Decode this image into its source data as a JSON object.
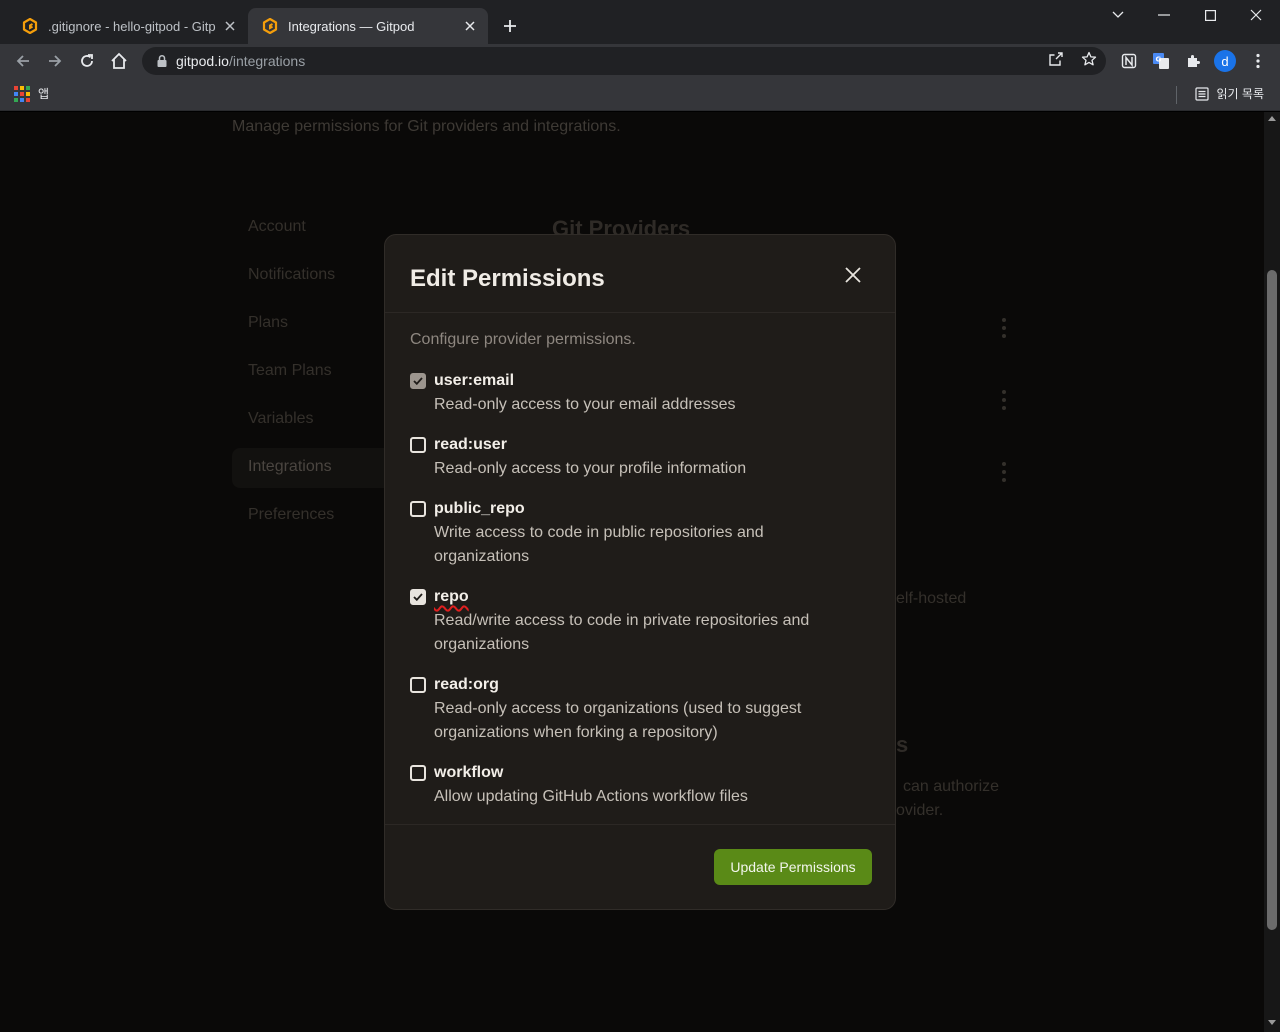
{
  "browser": {
    "tabs": [
      {
        "title": ".gitignore - hello-gitpod - Gitpod",
        "active": false
      },
      {
        "title": "Integrations — Gitpod",
        "active": true
      }
    ],
    "url_host": "gitpod.io",
    "url_path": "/integrations",
    "bookmarks": {
      "apps_label": "앱",
      "reading_list_label": "읽기 목록"
    },
    "profile_initial": "d",
    "colors": {
      "tab_favicon": "#f59e0b",
      "profile": "#1a73e8"
    }
  },
  "page": {
    "subtitle": "Manage permissions for Git providers and integrations.",
    "sidebar": [
      "Account",
      "Notifications",
      "Plans",
      "Team Plans",
      "Variables",
      "Integrations",
      "Preferences"
    ],
    "active_sidebar": "Integrations",
    "section_heading": "Git Providers",
    "partial_texts": {
      "self_hosted": "elf-hosted",
      "heading_fragment": "s",
      "authorize_fragment": "can authorize",
      "provider_fragment": "ovider."
    }
  },
  "modal": {
    "title": "Edit Permissions",
    "description": "Configure provider permissions.",
    "permissions": [
      {
        "name": "user:email",
        "description": "Read-only access to your email addresses",
        "checked": true,
        "disabled": true
      },
      {
        "name": "read:user",
        "description": "Read-only access to your profile information",
        "checked": false,
        "disabled": false
      },
      {
        "name": "public_repo",
        "description": "Write access to code in public repositories and organizations",
        "checked": false,
        "disabled": false
      },
      {
        "name": "repo",
        "description": "Read/write access to code in private repositories and organizations",
        "checked": true,
        "disabled": false
      },
      {
        "name": "read:org",
        "description": "Read-only access to organizations (used to suggest organizations when forking a repository)",
        "checked": false,
        "disabled": false
      },
      {
        "name": "workflow",
        "description": "Allow updating GitHub Actions workflow files",
        "checked": false,
        "disabled": false
      }
    ],
    "submit_label": "Update Permissions",
    "colors": {
      "submit": "#5a8a17"
    }
  }
}
